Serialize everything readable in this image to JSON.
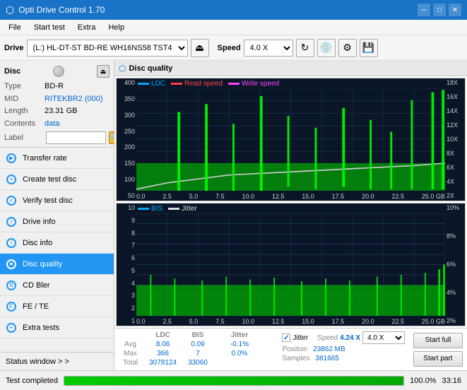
{
  "app": {
    "title": "Opti Drive Control 1.70",
    "titlebar_icon": "⬡"
  },
  "titlebar_controls": {
    "minimize": "─",
    "maximize": "□",
    "close": "✕"
  },
  "menubar": {
    "items": [
      "File",
      "Start test",
      "Extra",
      "Help"
    ]
  },
  "toolbar": {
    "drive_label": "Drive",
    "drive_value": "(L:)  HL-DT-ST BD-RE  WH16NS58 TST4",
    "speed_label": "Speed",
    "speed_value": "4.0 X"
  },
  "disc": {
    "title": "Disc",
    "type_label": "Type",
    "type_value": "BD-R",
    "mid_label": "MID",
    "mid_value": "RITEKBR2 (000)",
    "length_label": "Length",
    "length_value": "23.31 GB",
    "contents_label": "Contents",
    "contents_value": "data",
    "label_label": "Label",
    "label_value": ""
  },
  "nav": {
    "items": [
      {
        "id": "transfer-rate",
        "label": "Transfer rate",
        "active": false
      },
      {
        "id": "create-test-disc",
        "label": "Create test disc",
        "active": false
      },
      {
        "id": "verify-test-disc",
        "label": "Verify test disc",
        "active": false
      },
      {
        "id": "drive-info",
        "label": "Drive info",
        "active": false
      },
      {
        "id": "disc-info",
        "label": "Disc info",
        "active": false
      },
      {
        "id": "disc-quality",
        "label": "Disc quality",
        "active": true
      },
      {
        "id": "cd-bler",
        "label": "CD Bler",
        "active": false
      },
      {
        "id": "fe-te",
        "label": "FE / TE",
        "active": false
      },
      {
        "id": "extra-tests",
        "label": "Extra tests",
        "active": false
      }
    ]
  },
  "status_window": {
    "label": "Status window > >"
  },
  "disc_quality": {
    "title": "Disc quality"
  },
  "chart1": {
    "legend": [
      {
        "label": "LDC",
        "color": "#00aaff"
      },
      {
        "label": "Read speed",
        "color": "#ff4444"
      },
      {
        "label": "Write speed",
        "color": "#ff44ff"
      }
    ],
    "y_labels_left": [
      "400",
      "350",
      "300",
      "250",
      "200",
      "150",
      "100",
      "50",
      "0.0"
    ],
    "y_labels_right": [
      "18X",
      "16X",
      "14X",
      "12X",
      "10X",
      "8X",
      "6X",
      "4X",
      "2X"
    ],
    "x_labels": [
      "0.0",
      "2.5",
      "5.0",
      "7.5",
      "10.0",
      "12.5",
      "15.0",
      "17.5",
      "20.0",
      "22.5",
      "25.0 GB"
    ]
  },
  "chart2": {
    "legend": [
      {
        "label": "BIS",
        "color": "#00aaff"
      },
      {
        "label": "Jitter",
        "color": "#dddddd"
      }
    ],
    "y_labels_left": [
      "10",
      "9",
      "8",
      "7",
      "6",
      "5",
      "4",
      "3",
      "2",
      "1"
    ],
    "y_labels_right": [
      "10%",
      "8%",
      "6%",
      "4%",
      "2%"
    ],
    "x_labels": [
      "0.0",
      "2.5",
      "5.0",
      "7.5",
      "10.0",
      "12.5",
      "15.0",
      "17.5",
      "20.0",
      "22.5",
      "25.0 GB"
    ]
  },
  "stats": {
    "headers": [
      "LDC",
      "BIS",
      "",
      "Jitter",
      "Speed",
      ""
    ],
    "avg_label": "Avg",
    "avg_ldc": "8.06",
    "avg_bis": "0.09",
    "avg_jitter": "-0.1%",
    "max_label": "Max",
    "max_ldc": "366",
    "max_bis": "7",
    "max_jitter": "0.0%",
    "total_label": "Total",
    "total_ldc": "3078124",
    "total_bis": "33060",
    "jitter_label": "Jitter",
    "speed_label": "Speed",
    "speed_value": "4.24 X",
    "speed_select": "4.0 X",
    "position_label": "Position",
    "position_value": "23862 MB",
    "samples_label": "Samples",
    "samples_value": "381665",
    "start_full_label": "Start full",
    "start_part_label": "Start part"
  },
  "footer": {
    "status_text": "Test completed",
    "progress": 100,
    "progress_text": "100.0%",
    "time": "33:16"
  }
}
